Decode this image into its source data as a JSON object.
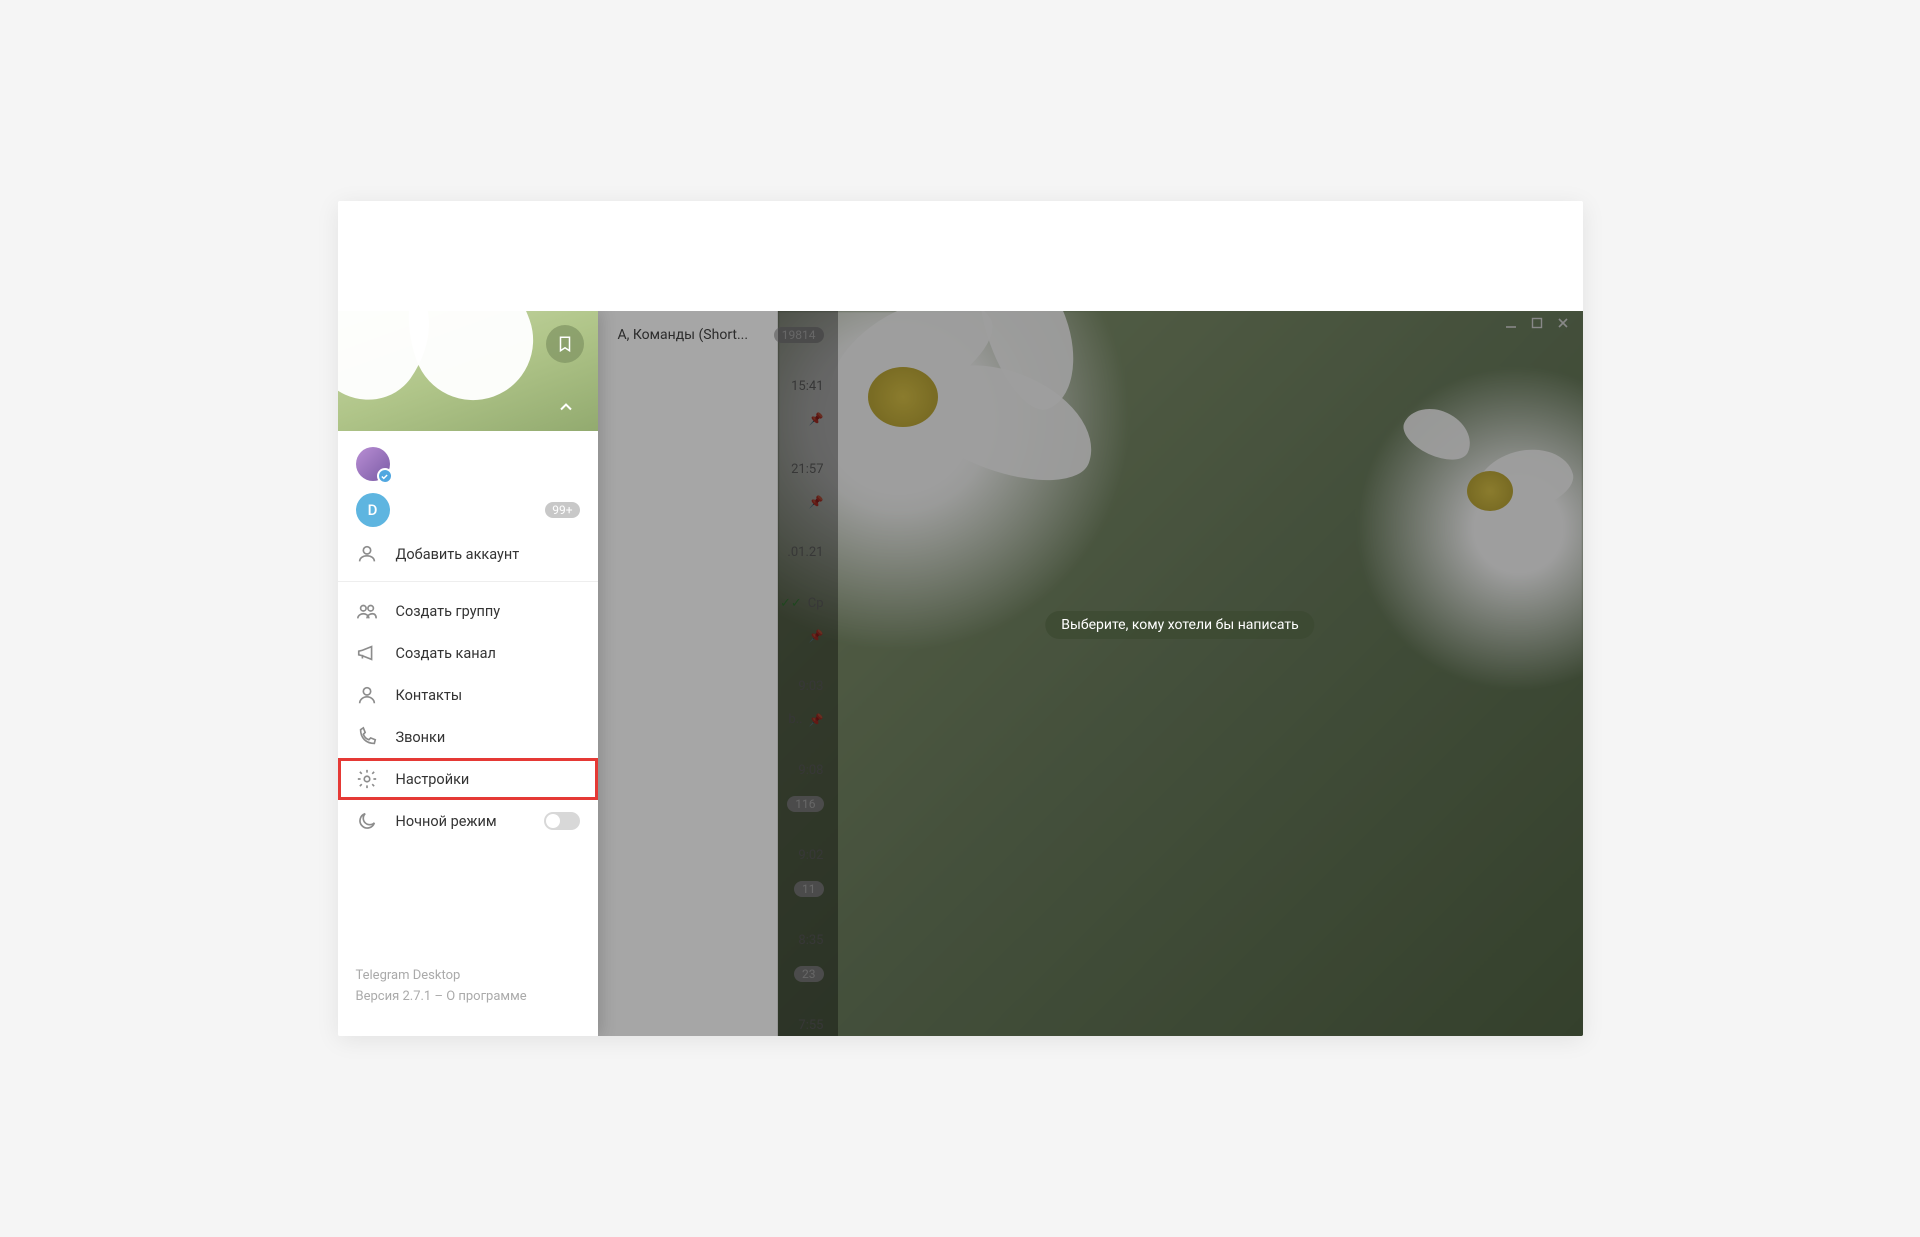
{
  "window": {
    "title": "Telegram Desktop"
  },
  "drawer": {
    "accounts": {
      "second_initial": "D",
      "second_badge": "99+",
      "add_account": "Добавить аккаунт"
    },
    "menu": {
      "new_group": "Создать группу",
      "new_channel": "Создать канал",
      "contacts": "Контакты",
      "calls": "Звонки",
      "settings": "Настройки",
      "night_mode": "Ночной режим"
    },
    "footer": {
      "app_name": "Telegram Desktop",
      "version_line": "Версия 2.7.1 – О программе"
    }
  },
  "chat_peek": {
    "row0_lead": "А, Команды (Short...",
    "row0_badge": "19814",
    "times": {
      "t1": "15:41",
      "t2": "21:57",
      "t3": ".01.21",
      "t4": "Ср",
      "t5": "9:03",
      "t6": "9:08",
      "t6_badge": "116",
      "t7": "9:02",
      "t7_badge": "11",
      "t8": "8:35",
      "t8_badge": "23",
      "t9": "7:55"
    }
  },
  "main": {
    "placeholder": "Выберите, кому хотели бы написать"
  }
}
